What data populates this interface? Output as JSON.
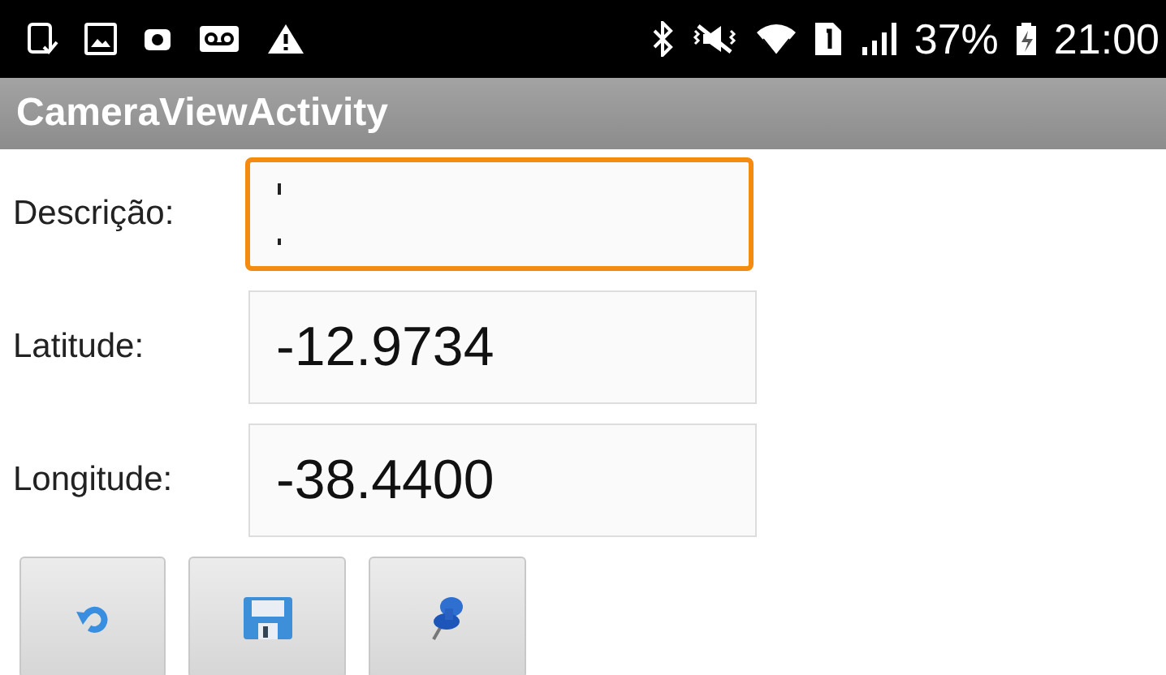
{
  "status_bar": {
    "battery": "37%",
    "time": "21:00"
  },
  "action_bar": {
    "title": "CameraViewActivity"
  },
  "fields": [
    {
      "label": "Descrição:",
      "focused": true
    },
    {
      "label": "Latitude:",
      "value": "-12.9734",
      "focused": false
    },
    {
      "label": "Longitude:",
      "value": "-38.4400",
      "focused": false
    }
  ],
  "buttons": [
    {
      "kind": "undo"
    },
    {
      "kind": "save"
    },
    {
      "kind": "pin"
    }
  ]
}
